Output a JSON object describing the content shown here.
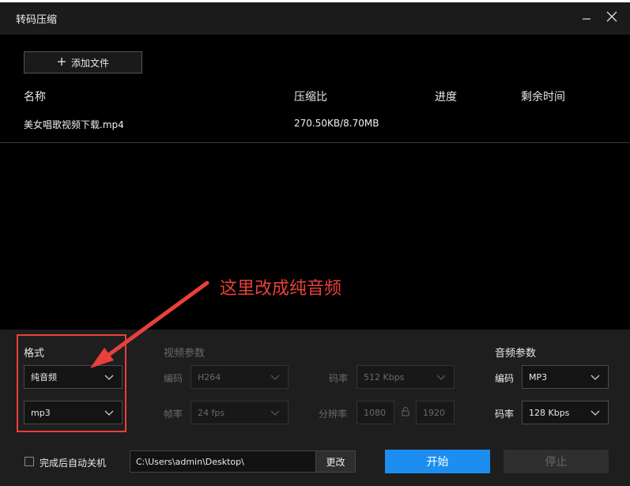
{
  "window": {
    "title": "转码压缩"
  },
  "toolbar": {
    "add_file_label": "添加文件"
  },
  "table": {
    "columns": [
      "名称",
      "压缩比",
      "进度",
      "剩余时间"
    ],
    "rows": [
      {
        "name": "美女唱歌视频下载.mp4",
        "ratio": "270.50KB/8.70MB",
        "progress": "",
        "remaining": ""
      }
    ]
  },
  "annotation": {
    "text": "这里改成纯音频",
    "color": "#e8403a"
  },
  "format": {
    "title": "格式",
    "type_value": "纯音频",
    "container_value": "mp3"
  },
  "video": {
    "title": "视频参数",
    "codec_label": "编码",
    "codec_value": "H264",
    "framerate_label": "帧率",
    "framerate_value": "24 fps",
    "bitrate_label": "码率",
    "bitrate_value": "512 Kbps",
    "resolution_label": "分辨率",
    "width_value": "1080",
    "height_value": "1920"
  },
  "audio": {
    "title": "音频参数",
    "codec_label": "编码",
    "codec_value": "MP3",
    "bitrate_label": "码率",
    "bitrate_value": "128 Kbps"
  },
  "footer": {
    "shutdown_label": "完成后自动关机",
    "output_path": "C:\\Users\\admin\\Desktop\\",
    "change_label": "更改",
    "start_label": "开始",
    "stop_label": "停止"
  },
  "colors": {
    "accent": "#1c8ef0",
    "annotation": "#e8403a",
    "panel": "#1e1e1e"
  }
}
